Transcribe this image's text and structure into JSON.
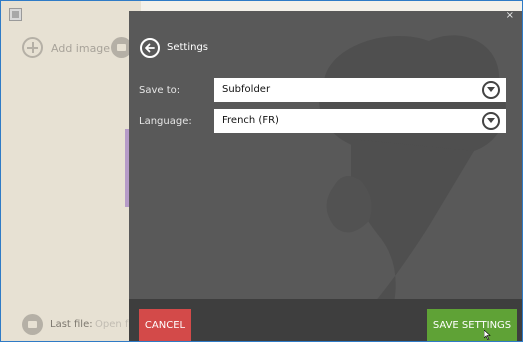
{
  "background_app": {
    "add_image_label": "Add image",
    "last_file_label": "Last file:",
    "open_label": "Open fo"
  },
  "dialog": {
    "title": "Settings",
    "close_glyph": "×",
    "fields": [
      {
        "label": "Save to:",
        "value": "Subfolder"
      },
      {
        "label": "Language:",
        "value": "French (FR)"
      }
    ],
    "cancel_label": "CANCEL",
    "save_label": "SAVE SETTINGS"
  },
  "colors": {
    "overlay": "#595959",
    "cancel": "#d34a49",
    "save": "#5fa236",
    "footer": "#3e3e3e"
  },
  "icons": [
    "app-icon",
    "add-icon",
    "folder-icon",
    "back-arrow-icon",
    "close-icon",
    "chevron-down-icon",
    "ice-cream-watermark"
  ]
}
